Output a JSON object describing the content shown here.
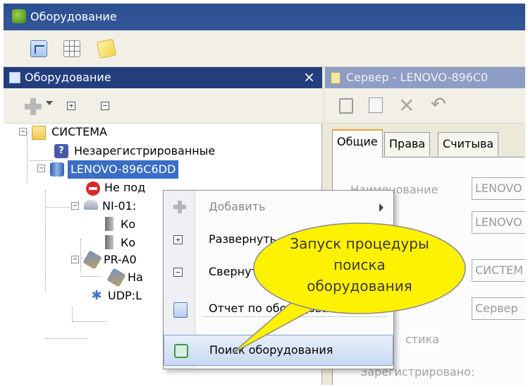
{
  "window": {
    "title": "Оборудование"
  },
  "toolbar": {
    "icons": [
      "tree-view-icon",
      "grid-view-icon",
      "notes-icon"
    ]
  },
  "left_panel": {
    "title": "Оборудование",
    "close_glyph": "×",
    "tools": {
      "plus_box": "+",
      "minus_box": "−"
    },
    "tree": {
      "system": "СИСТЕМА",
      "unregistered": "Незарегистрированные",
      "lenovo": "LENOVO-896C6DD",
      "not_connected": "Не под",
      "ni01": "NI-01:",
      "ko1": "Ко",
      "ko2": "Ко",
      "pra0": "PR-A0",
      "na": "На",
      "udp": "UDP:L"
    }
  },
  "right_panel": {
    "title": "Сервер - LENOVO-896C0",
    "toolbar": {
      "delete_glyph": "✕",
      "undo_glyph": "↶"
    },
    "tabs": [
      "Общие",
      "Права",
      "Считыва"
    ],
    "fields": [
      {
        "label": "Наименование",
        "value": "LENOVO"
      },
      {
        "label": "",
        "value": "LENOVO"
      },
      {
        "label": "",
        "value": "СИСТЕМ"
      },
      {
        "label": "",
        "value": "Сервер"
      }
    ],
    "group_label": "стика",
    "registered_label": "Зарегистрировано:"
  },
  "context_menu": {
    "items": [
      {
        "label": "Добавить",
        "state": "disabled",
        "submenu": true
      },
      {
        "label": "Развернуть",
        "icon_glyph": "+"
      },
      {
        "label": "Свернуть",
        "icon_glyph": "−"
      },
      {
        "label": "Отчет по оборудованию"
      },
      {
        "label": "Поиск оборудования",
        "state": "hover"
      }
    ]
  },
  "callout": {
    "lines": [
      "Запуск процедуры",
      "поиска",
      "оборудования"
    ],
    "fill": "#fff200"
  }
}
